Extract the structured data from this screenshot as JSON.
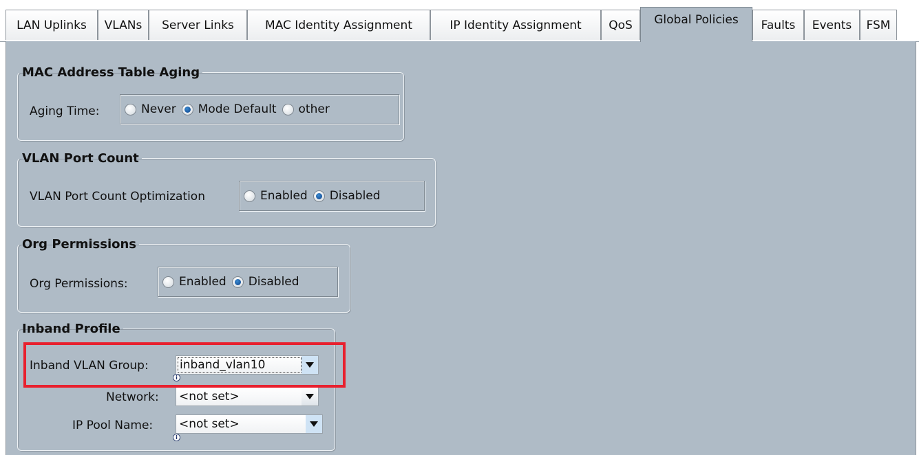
{
  "tabs": [
    {
      "label": "LAN Uplinks",
      "active": false
    },
    {
      "label": "VLANs",
      "active": false
    },
    {
      "label": "Server Links",
      "active": false
    },
    {
      "label": "MAC Identity Assignment",
      "active": false
    },
    {
      "label": "IP Identity Assignment",
      "active": false
    },
    {
      "label": "QoS",
      "active": false
    },
    {
      "label": "Global Policies",
      "active": true
    },
    {
      "label": "Faults",
      "active": false
    },
    {
      "label": "Events",
      "active": false
    },
    {
      "label": "FSM",
      "active": false
    }
  ],
  "mac_aging": {
    "title": "MAC Address Table Aging",
    "label": "Aging Time:",
    "options": [
      "Never",
      "Mode Default",
      "other"
    ],
    "selected": "Mode Default"
  },
  "vlan_port_count": {
    "title": "VLAN Port Count",
    "label": "VLAN Port Count Optimization",
    "options": [
      "Enabled",
      "Disabled"
    ],
    "selected": "Disabled"
  },
  "org_permissions": {
    "title": "Org Permissions",
    "label": "Org Permissions:",
    "options": [
      "Enabled",
      "Disabled"
    ],
    "selected": "Disabled"
  },
  "inband_profile": {
    "title": "Inband Profile",
    "vlan_group_label": "Inband VLAN Group:",
    "vlan_group_value": "inband_vlan10",
    "network_label": "Network:",
    "network_value": "<not set>",
    "ip_pool_label": "IP Pool Name:",
    "ip_pool_value": "<not set>",
    "info_icon_glyph": "i"
  },
  "colors": {
    "panel_bg": "#afbbc6",
    "highlight": "#e8202e",
    "radio_selected": "#0b3f88"
  },
  "icons": {
    "dropdown": "chevron-down-icon",
    "info": "info-icon"
  }
}
